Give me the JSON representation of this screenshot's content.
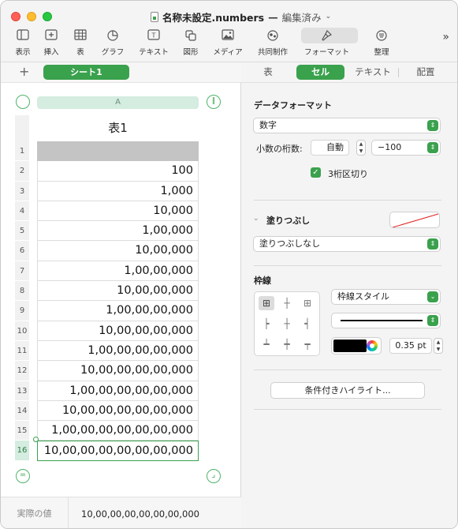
{
  "window": {
    "file_name": "名称未設定.numbers",
    "separator": "—",
    "status": "編集済み",
    "status_chevron": "chevron-down-icon"
  },
  "toolbar": {
    "items": [
      {
        "label": "表示",
        "icon": "sidebar-icon"
      },
      {
        "label": "挿入",
        "icon": "insert-plus-icon"
      },
      {
        "label": "表",
        "icon": "table-icon"
      },
      {
        "label": "グラフ",
        "icon": "chart-pie-icon"
      },
      {
        "label": "テキスト",
        "icon": "textbox-icon"
      },
      {
        "label": "図形",
        "icon": "shape-icon"
      },
      {
        "label": "メディア",
        "icon": "image-icon"
      },
      {
        "label": "共同制作",
        "icon": "collaborate-icon"
      },
      {
        "label": "フォーマット",
        "icon": "paintbrush-icon"
      },
      {
        "label": "整理",
        "icon": "organize-icon"
      }
    ],
    "more_icon": "chevron-double-right-icon"
  },
  "sheet": {
    "add_icon": "plus-icon",
    "tab_label": "シート1"
  },
  "table": {
    "column_header": "A",
    "title": "表1",
    "row_numbers": [
      "1",
      "2",
      "3",
      "4",
      "5",
      "6",
      "7",
      "8",
      "9",
      "10",
      "11",
      "12",
      "13",
      "14",
      "15",
      "16"
    ],
    "cells": [
      "",
      "100",
      "1,000",
      "10,000",
      "1,00,000",
      "10,00,000",
      "1,00,00,000",
      "10,00,00,000",
      "1,00,00,00,000",
      "10,00,00,00,000",
      "1,00,00,00,00,000",
      "10,00,00,00,00,000",
      "1,00,00,00,00,00,000",
      "10,00,00,00,00,00,000",
      "1,00,00,00,00,00,00,000",
      "10,00,00,00,00,00,00,000"
    ],
    "selected_row": 16
  },
  "value_bar": {
    "label": "実際の値",
    "value": "10,00,00,00,00,00,00,000"
  },
  "inspector": {
    "tabs": [
      "表",
      "セル",
      "テキスト",
      "配置"
    ],
    "active_tab": "セル",
    "data_format": {
      "title": "データフォーマット",
      "format": "数字",
      "decimals_label": "小数の桁数:",
      "decimals_value": "自動",
      "negative_format": "−100",
      "thousands_label": "3桁区切り",
      "thousands_checked": true
    },
    "fill": {
      "title": "塗りつぶし",
      "value": "塗りつぶしなし"
    },
    "border": {
      "title": "枠線",
      "style": "枠線スタイル",
      "width": "0.35 pt",
      "color": "#000000"
    },
    "conditional_button": "条件付きハイライト..."
  },
  "colors": {
    "accent": "#3aa14d",
    "header_fill": "#c4c4c4"
  }
}
